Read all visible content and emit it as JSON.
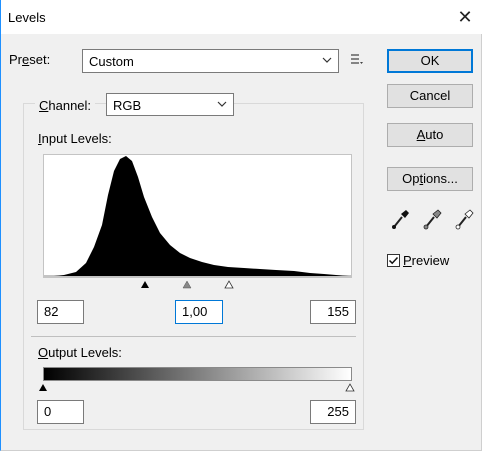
{
  "window": {
    "title": "Levels",
    "close_glyph": "✕"
  },
  "preset": {
    "label_prefix": "Pr",
    "label_underline": "e",
    "label_suffix": "set:",
    "value": "Custom"
  },
  "channel": {
    "label_underline": "C",
    "label_suffix": "hannel:",
    "value": "RGB"
  },
  "input_levels": {
    "label_underline": "I",
    "label_suffix": "nput Levels:",
    "shadow": "82",
    "midtone": "1,00",
    "highlight": "155"
  },
  "output_levels": {
    "label_underline": "O",
    "label_suffix": "utput Levels:",
    "shadow": "0",
    "highlight": "255"
  },
  "buttons": {
    "ok": "OK",
    "cancel": "Cancel",
    "auto_underline": "A",
    "auto_suffix": "uto",
    "options_prefix": "Op",
    "options_underline": "t",
    "options_suffix": "ions..."
  },
  "preview": {
    "label_underline": "P",
    "label_suffix": "review",
    "checked": true
  },
  "icons": [
    "presets-menu-icon",
    "black-eyedropper-icon",
    "gray-eyedropper-icon",
    "white-eyedropper-icon"
  ],
  "colors": {
    "accent": "#0078d7",
    "dialog_bg": "#f0f0f0"
  }
}
